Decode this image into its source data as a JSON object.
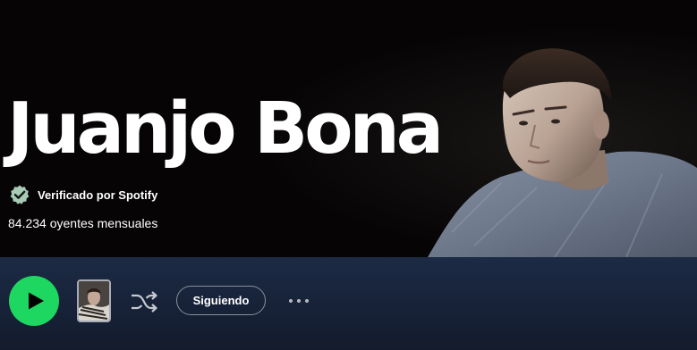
{
  "artist": {
    "name": "Juanjo Bona",
    "verified_label": "Verificado por Spotify",
    "monthly_listeners": "84.234 oyentes mensuales"
  },
  "actions": {
    "play_icon": "play-icon",
    "shuffle_icon": "shuffle-icon",
    "follow_label": "Siguiendo",
    "more_icon": "more-options-icon"
  },
  "colors": {
    "accent": "#1ed760",
    "verified_badge": "#4cb3ff",
    "action_bar": "#172238"
  }
}
